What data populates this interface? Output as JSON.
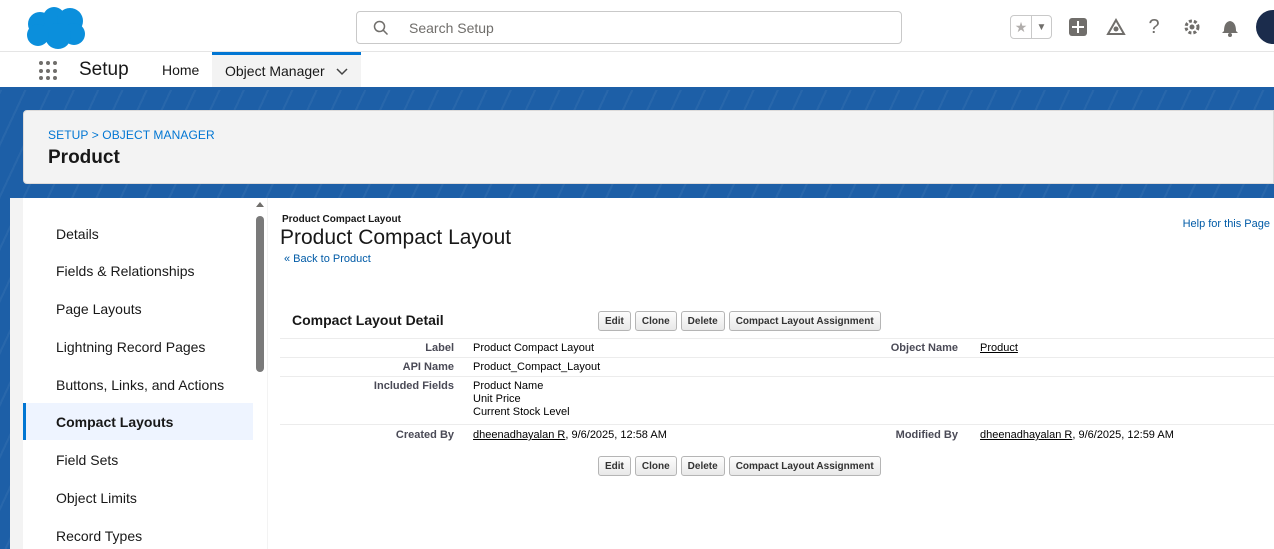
{
  "header": {
    "search_placeholder": "Search Setup"
  },
  "nav": {
    "app_name": "Setup",
    "tabs": [
      {
        "label": "Home"
      },
      {
        "label": "Object Manager"
      }
    ]
  },
  "page_header": {
    "breadcrumb": "SETUP > OBJECT MANAGER",
    "title": "Product"
  },
  "sidebar": {
    "items": [
      {
        "label": "Details"
      },
      {
        "label": "Fields & Relationships"
      },
      {
        "label": "Page Layouts"
      },
      {
        "label": "Lightning Record Pages"
      },
      {
        "label": "Buttons, Links, and Actions"
      },
      {
        "label": "Compact Layouts"
      },
      {
        "label": "Field Sets"
      },
      {
        "label": "Object Limits"
      },
      {
        "label": "Record Types"
      }
    ],
    "active_index": 5
  },
  "main": {
    "small_title": "Product Compact Layout",
    "title": "Product Compact Layout",
    "back_link": "« Back to Product",
    "help_link": "Help for this Page",
    "detail_section_title": "Compact Layout Detail",
    "buttons": {
      "edit": "Edit",
      "clone": "Clone",
      "delete": "Delete",
      "assignment": "Compact Layout Assignment"
    },
    "fields": {
      "label_label": "Label",
      "label_value": "Product Compact Layout",
      "object_name_label": "Object Name",
      "object_name_value": "Product",
      "api_name_label": "API Name",
      "api_name_value": "Product_Compact_Layout",
      "included_fields_label": "Included Fields",
      "included_fields": [
        "Product Name",
        "Unit Price",
        "Current Stock Level"
      ],
      "created_by_label": "Created By",
      "created_by_user": "dheenadhayalan R",
      "created_by_date": ", 9/6/2025, 12:58 AM",
      "modified_by_label": "Modified By",
      "modified_by_user": "dheenadhayalan R",
      "modified_by_date": ", 9/6/2025, 12:59 AM"
    }
  },
  "colors": {
    "brand_blue": "#0176d3",
    "banner_blue": "#1d5fa7",
    "cloud_blue": "#0b8fdc"
  }
}
